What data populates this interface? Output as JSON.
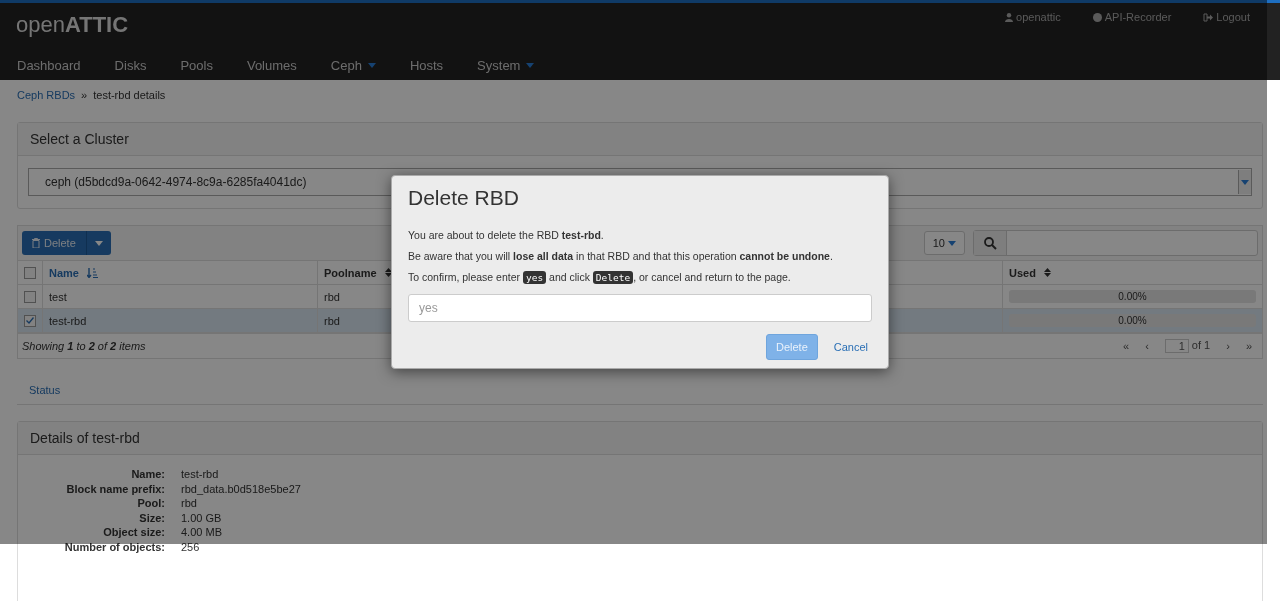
{
  "navbar": {
    "logo_light": "open",
    "logo_bold": "ATTIC",
    "items": [
      {
        "label": "Dashboard",
        "dropdown": false
      },
      {
        "label": "Disks",
        "dropdown": false
      },
      {
        "label": "Pools",
        "dropdown": false
      },
      {
        "label": "Volumes",
        "dropdown": false
      },
      {
        "label": "Ceph",
        "dropdown": true
      },
      {
        "label": "Hosts",
        "dropdown": false
      },
      {
        "label": "System",
        "dropdown": true
      }
    ],
    "user": "openattic",
    "recorder": "API-Recorder",
    "logout": "Logout"
  },
  "breadcrumb": {
    "link": "Ceph RBDs",
    "separator": "»",
    "current": "test-rbd details"
  },
  "cluster_panel": {
    "title": "Select a Cluster",
    "value": "ceph (d5bdcd9a-0642-4974-8c9a-6285fa4041dc)"
  },
  "toolbar": {
    "action": "Delete",
    "page_size": "10"
  },
  "table": {
    "all_checked": false,
    "columns": [
      {
        "label": "Name",
        "sorted": true
      },
      {
        "label": "Poolname",
        "sorted": false
      },
      {
        "label": "Used",
        "sorted": false
      }
    ],
    "rows": [
      {
        "name": "test",
        "pool": "rbd",
        "checked": false,
        "level": 0,
        "reading": "0.00%"
      },
      {
        "name": "test-rbd",
        "pool": "rbd",
        "checked": true,
        "level": 0,
        "reading": "0.00%"
      }
    ],
    "footer": "Showing **1** to **2** of **2** items",
    "pagination": {
      "first": "«",
      "previous": "‹",
      "page": "1",
      "total": "of 1",
      "next": "›",
      "last": "»"
    }
  },
  "tabs": [
    {
      "label": "Status",
      "selected": false
    }
  ],
  "details": {
    "title": "Details of test-rbd",
    "fields": [
      {
        "label": "Name:",
        "value": "test-rbd"
      },
      {
        "label": "Block name prefix:",
        "value": "rbd_data.b0d518e5be27"
      },
      {
        "label": "Pool:",
        "value": "rbd"
      },
      {
        "label": "Size:",
        "value": "1.00 GB"
      },
      {
        "label": "Object size:",
        "value": "4.00 MB"
      },
      {
        "label": "Number of objects:",
        "value": "256"
      }
    ]
  },
  "modal": {
    "title": "Delete RBD",
    "paragraphs": [
      [
        {
          "kind": "text",
          "text": "You are about to delete the RBD **test-rbd**."
        }
      ],
      [
        {
          "kind": "text",
          "text": "Be aware that you will **lose all data** in that RBD and that this operation **cannot be undone**."
        }
      ],
      [
        {
          "kind": "text",
          "text": "To confirm, please enter "
        },
        {
          "kind": "code",
          "text": "yes"
        },
        {
          "kind": "text",
          "text": " and click "
        },
        {
          "kind": "code",
          "text": "Delete"
        },
        {
          "kind": "text",
          "text": ", or cancel and return to the page."
        }
      ]
    ],
    "placeholder": "yes",
    "confirm": {
      "label": "Delete",
      "disabled": true
    },
    "cancel": "Cancel"
  }
}
